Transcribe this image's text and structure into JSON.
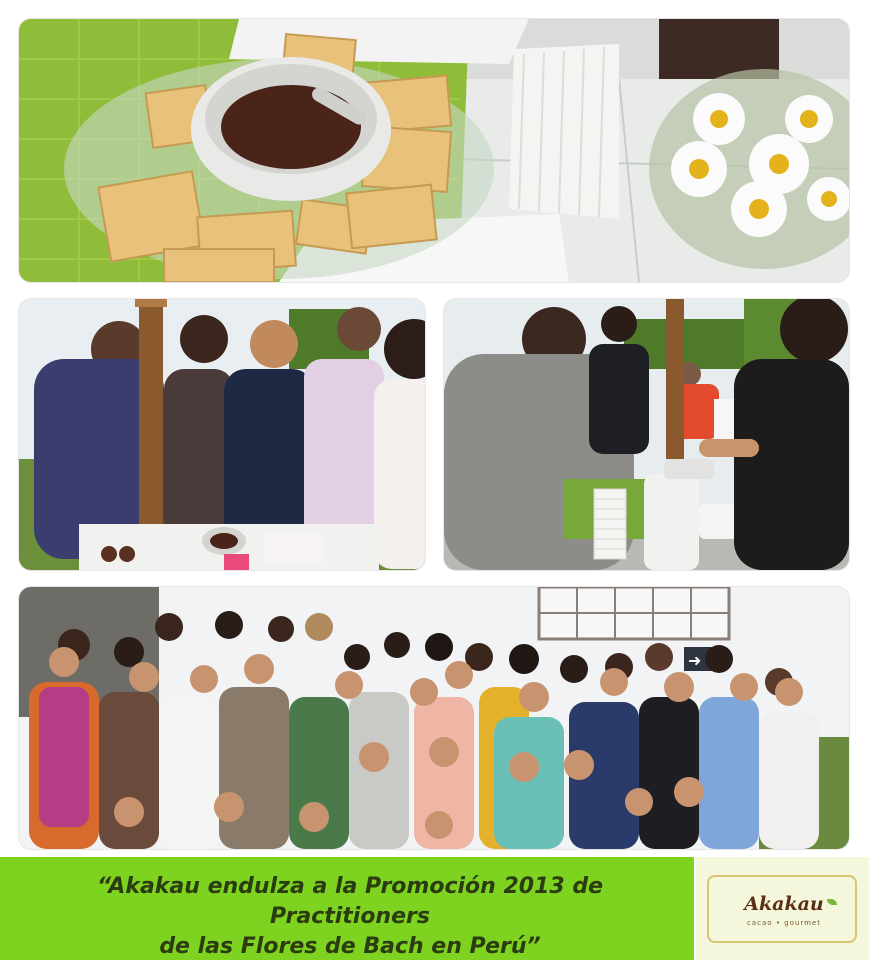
{
  "caption": {
    "line1": "“Akakau endulza a la Promoción 2013 de Practitioners",
    "line2": "de las Flores de Bach en Perú”"
  },
  "logo": {
    "wordmark": "Akakau",
    "tagline": "cacao • gourmet"
  },
  "colors": {
    "band_green": "#7ed320",
    "logo_background": "#f5f7dc",
    "logo_text": "#5a2f14"
  },
  "photos": [
    {
      "name": "snacks-table"
    },
    {
      "name": "tasting-left"
    },
    {
      "name": "tasting-right"
    },
    {
      "name": "group-photo"
    }
  ]
}
